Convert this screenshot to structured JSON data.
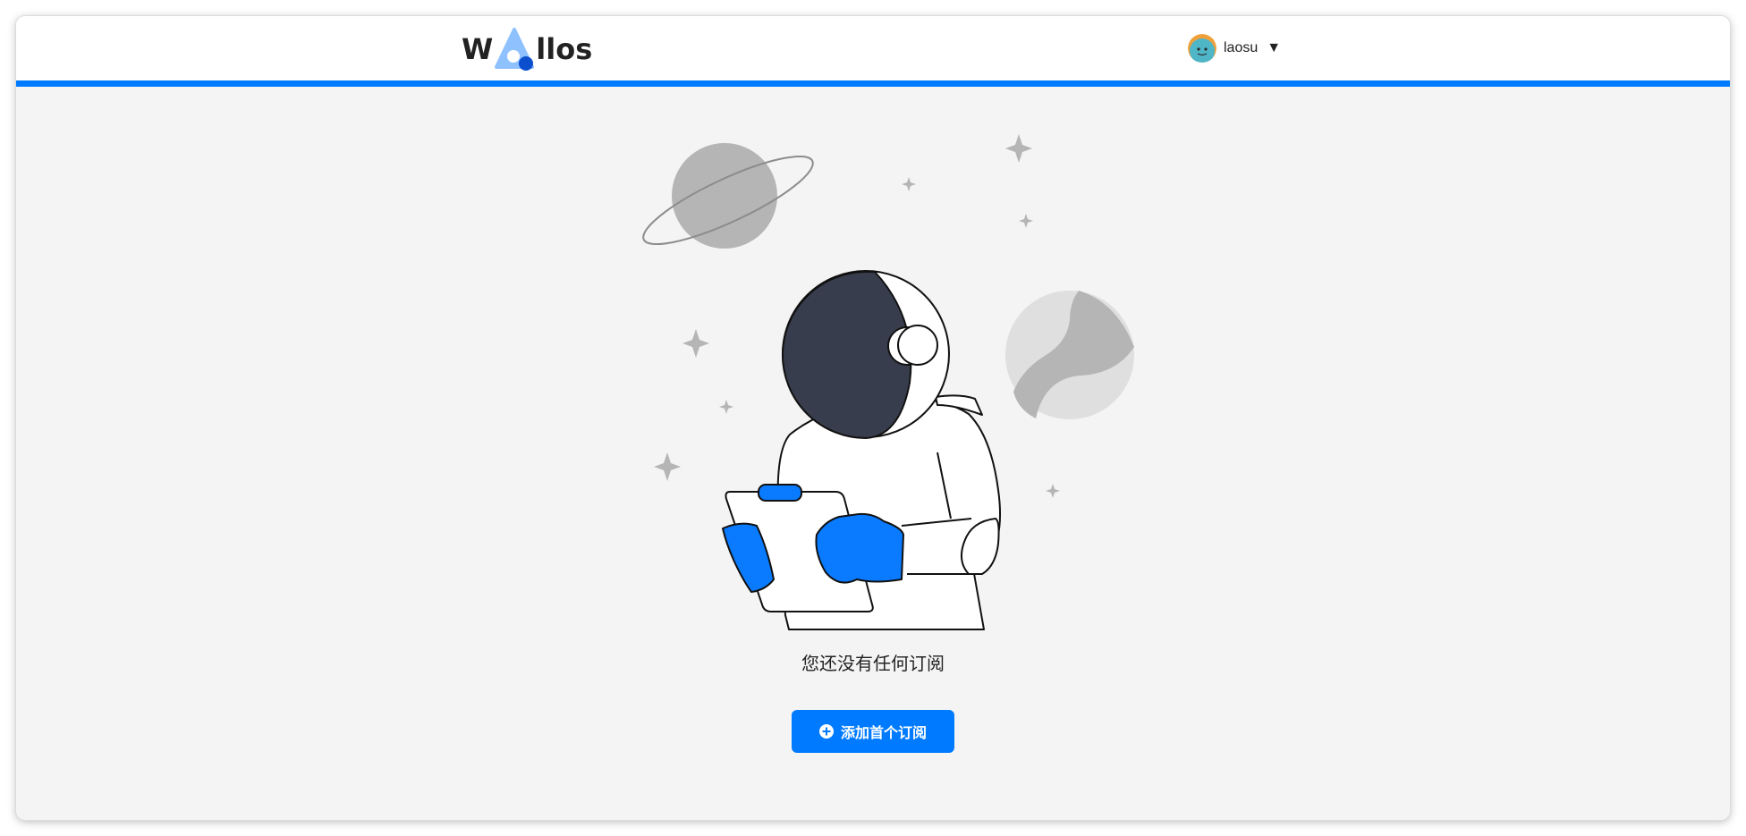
{
  "header": {
    "logo": {
      "text_before": "W",
      "text_after": "llos"
    },
    "user": {
      "name": "laosu",
      "menu_caret": "▼"
    }
  },
  "main": {
    "empty_message": "您还没有任何订阅",
    "add_button_label": "添加首个订阅",
    "add_button_icon": "plus-circle-icon",
    "illustration": "astronaut-with-clipboard-illustration"
  },
  "colors": {
    "accent": "#007bff",
    "background": "#f4f4f4",
    "header_background": "#ffffff",
    "text": "#222222",
    "helmet_visor": "#373d4c"
  }
}
